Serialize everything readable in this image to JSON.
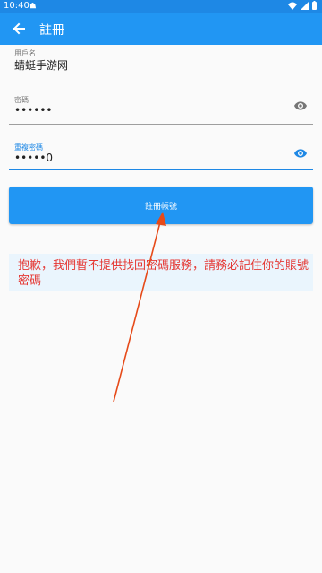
{
  "status_bar": {
    "time": "10:40"
  },
  "app_bar": {
    "title": "註冊"
  },
  "form": {
    "username": {
      "label": "用戶名",
      "value": "蜻蜓手游网"
    },
    "password": {
      "label": "密碼",
      "value": "••••••"
    },
    "confirm_password": {
      "label": "重複密碼",
      "value": "•••••0"
    }
  },
  "register_button": {
    "label": "註冊帳號"
  },
  "notice": {
    "text": "抱歉，我們暫不提供找回密碼服務，請務必記住你的賬號密碼"
  },
  "colors": {
    "primary": "#2196f3",
    "status_bar": "#1e88e5",
    "notice_text": "#e53935",
    "notice_bg": "#eaf5fd",
    "annotation_arrow": "#e64a19"
  }
}
